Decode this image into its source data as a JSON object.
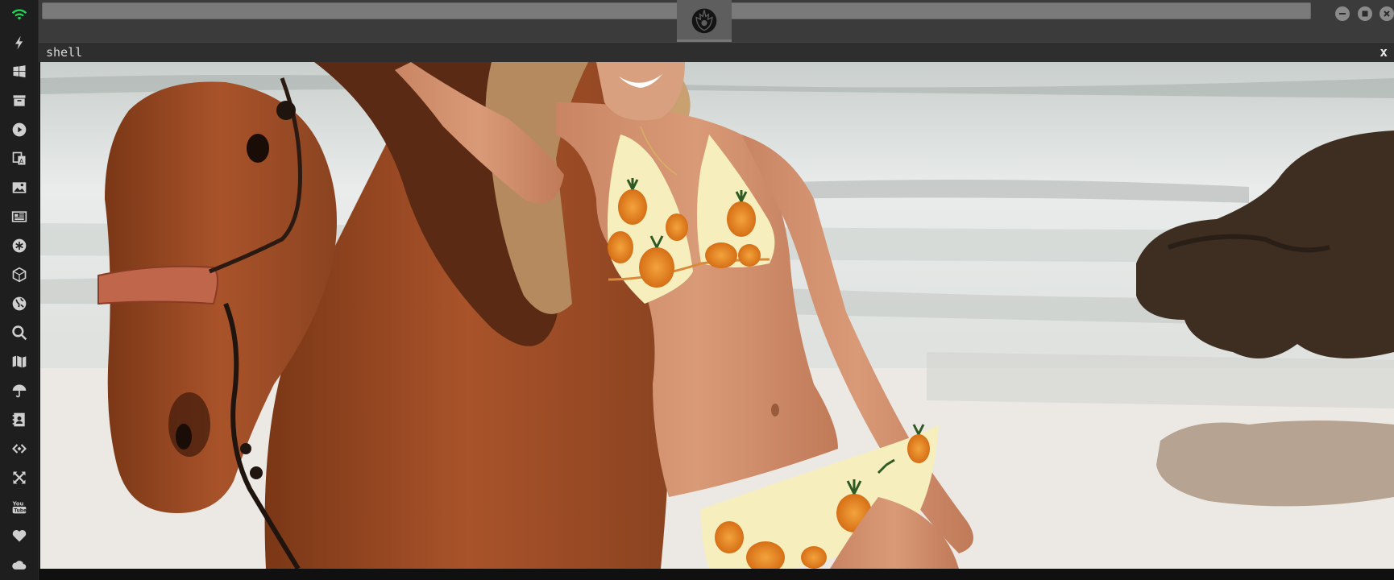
{
  "window": {
    "title": "shell",
    "close_label": "x"
  },
  "topbar": {
    "logo_icon": "rebel-alliance-logo-icon"
  },
  "dock": {
    "items": [
      "wifi-icon",
      "lightning-icon",
      "windows-icon",
      "archive-icon",
      "play-icon",
      "translate-icon",
      "image-icon",
      "news-icon",
      "asterisk-circle-icon",
      "cube-icon",
      "globe-icon",
      "search-icon",
      "map-icon",
      "umbrella-icon",
      "contact-card-icon",
      "code-icon",
      "expand-icon",
      "youtube-icon",
      "heart-icon",
      "cloud-icon"
    ]
  },
  "colors": {
    "dock_bg": "#1e1e1e",
    "topbar_bg": "#3b3b3b",
    "window_header_bg": "#2e2e2e",
    "wifi_accent": "#1fd655"
  }
}
